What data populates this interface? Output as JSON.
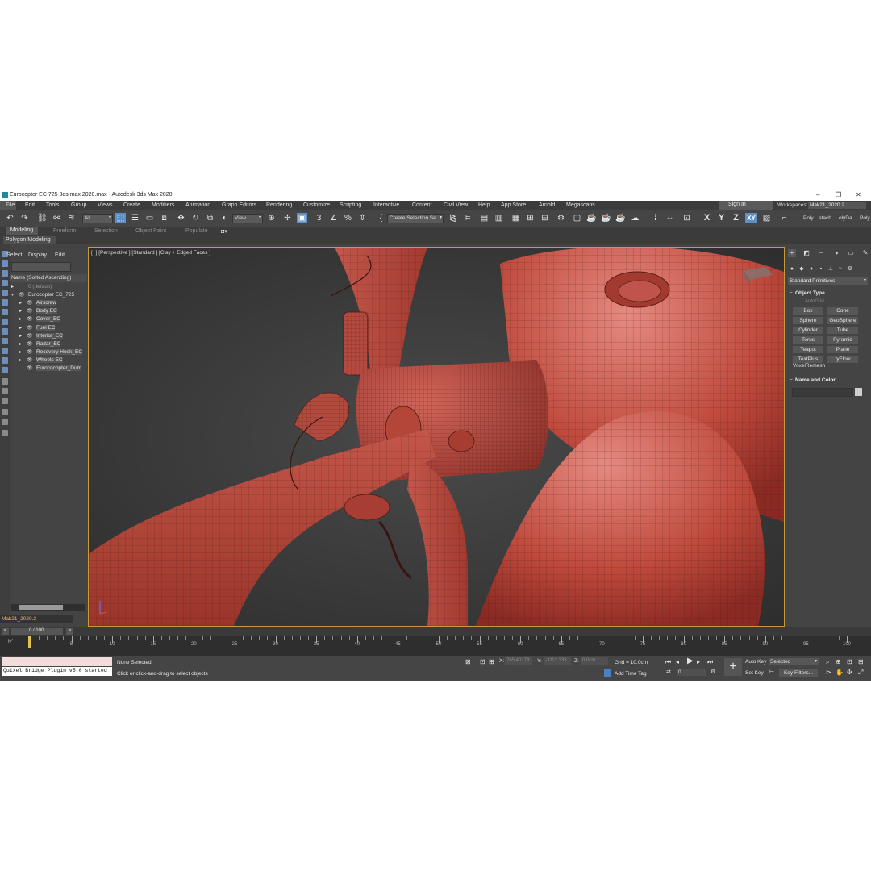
{
  "window": {
    "title": "Eurocopter EC 725 3ds max 2020.max - Autodesk 3ds Max 2020",
    "minimize": "‒",
    "restore": "❐",
    "close": "✕"
  },
  "menubar": {
    "items": [
      "File",
      "Edit",
      "Tools",
      "Group",
      "Views",
      "Create",
      "Modifiers",
      "Animation",
      "Graph Editors",
      "Rendering",
      "Customize",
      "Scripting",
      "Interactive",
      "Content",
      "Civil View",
      "Help",
      "App Store",
      "Arnold",
      "Megascans"
    ],
    "sign_in": "Sign In",
    "workspaces_label": "Workspaces:",
    "workspace_value": "Mak21_2020.2"
  },
  "toolbar": {
    "filter_value": "All",
    "ref_coord_value": "View",
    "named_selection_placeholder": "Create Selection Se",
    "axes": [
      "X",
      "Y",
      "Z",
      "XY"
    ],
    "right_tabs": [
      "Poly",
      "etach",
      "olyDa",
      "Poly"
    ]
  },
  "ribbon": {
    "tabs": [
      "Modeling",
      "Freeform",
      "Selection",
      "Object Paint",
      "Populate"
    ],
    "panel": "Polygon Modeling"
  },
  "explorer": {
    "menus": [
      "Select",
      "Display",
      "Edit"
    ],
    "header": "Name (Sorted Ascending)",
    "rows": [
      {
        "name": "0 (default)",
        "indent": 1,
        "expand": "▸",
        "eye": "",
        "dim": true
      },
      {
        "name": "Eurocopter EC_725",
        "indent": 1,
        "expand": "▾",
        "eye": "👁",
        "dim": false
      },
      {
        "name": "Airscrew",
        "indent": 2,
        "expand": "▸",
        "eye": "👁",
        "dim": false
      },
      {
        "name": "Body EC",
        "indent": 2,
        "expand": "▸",
        "eye": "👁",
        "dim": false
      },
      {
        "name": "Cover_EC",
        "indent": 2,
        "expand": "▸",
        "eye": "👁",
        "dim": false
      },
      {
        "name": "Fuel EC",
        "indent": 2,
        "expand": "▸",
        "eye": "👁",
        "dim": false
      },
      {
        "name": "Interior_EC",
        "indent": 2,
        "expand": "▸",
        "eye": "👁",
        "dim": false
      },
      {
        "name": "Radar_EC",
        "indent": 2,
        "expand": "▸",
        "eye": "👁",
        "dim": false
      },
      {
        "name": "Recovery Hook_EC",
        "indent": 2,
        "expand": "▸",
        "eye": "👁",
        "dim": false
      },
      {
        "name": "Wheels EC",
        "indent": 2,
        "expand": "▸",
        "eye": "👁",
        "dim": false
      },
      {
        "name": "Eurococopter_Dum",
        "indent": 2,
        "expand": "",
        "eye": "👁",
        "dim": false
      }
    ],
    "layer_value": "Mak21_2020.2"
  },
  "viewport": {
    "label": "[+] [Perspective ] [Standard ] [Clay + Edged Faces ]",
    "mesh_color": "#b8463a",
    "bg_color": "#3a3a3a"
  },
  "command_panel": {
    "category": "Standard Primitives",
    "object_type_title": "Object Type",
    "autogrid": "AutoGrid",
    "primitives": [
      "Box",
      "Cone",
      "Sphere",
      "GeoSphere",
      "Cylinder",
      "Tube",
      "Torus",
      "Pyramid",
      "Teapot",
      "Plane",
      "TextPlus",
      "tyFlow"
    ],
    "voxel": "VoxelRemesh",
    "name_color_title": "Name and Color"
  },
  "timeslider": {
    "frame_display": "0 / 100",
    "prev": "<",
    "next": ">"
  },
  "trackbar": {
    "tick_labels": [
      "0",
      "5",
      "10",
      "15",
      "20",
      "25",
      "30",
      "35",
      "40",
      "45",
      "50",
      "55",
      "60",
      "65",
      "70",
      "75",
      "80",
      "85",
      "90",
      "95",
      "100"
    ]
  },
  "status": {
    "maxscript_output": "Quixel Bridge Plugin v5.0 started",
    "selection": "None Selected",
    "prompt": "Click or click-and-drag to select objects",
    "x_label": "X:",
    "x_value": "765.40173",
    "y_label": "Y:",
    "y_value": "-3112.333",
    "z_label": "Z:",
    "z_value": "0.0cm",
    "grid": "Grid = 10.0cm",
    "add_time_tag": "Add Time Tag",
    "frame_value": "0",
    "auto_key": "Auto Key",
    "set_key": "Set Key",
    "selected_value": "Selected",
    "key_filters": "Key Filters..."
  }
}
